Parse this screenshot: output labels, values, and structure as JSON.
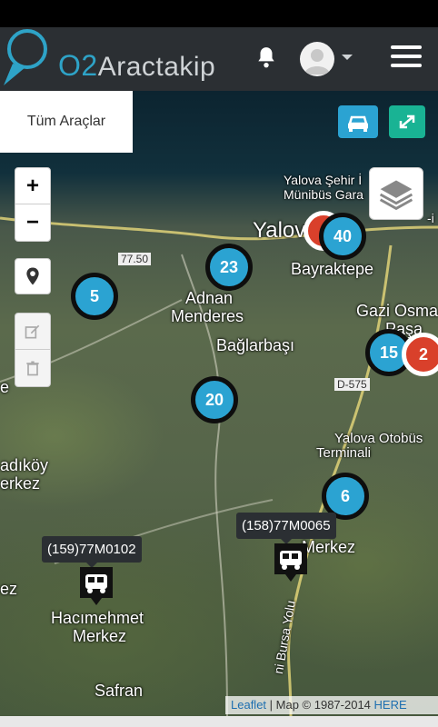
{
  "app": {
    "logo_prefix": "O2",
    "logo_suffix": "Aractakip"
  },
  "header": {
    "bell_icon": "bell-icon",
    "avatar_icon": "user-avatar-icon",
    "menu_icon": "hamburger-menu-icon"
  },
  "filter": {
    "tab_label": "Tüm Araçlar"
  },
  "toolbar": {
    "vehicle_button_icon": "car-icon",
    "fullscreen_button_icon": "expand-icon",
    "accent_blue": "#2ba3d2",
    "accent_green": "#19b394"
  },
  "map_controls": {
    "zoom_in": "+",
    "zoom_out": "−",
    "locate_icon": "map-pin-icon",
    "edit_icon": "edit-icon",
    "delete_icon": "trash-icon",
    "layers_icon": "layers-icon"
  },
  "place_labels": {
    "yalova_sehir": "Yalova Şehir İ",
    "munibus": "Münibüs Gara",
    "yalova": "Yalova",
    "yalova_i": "-i",
    "bayraktepe": "Bayraktepe",
    "adnan": "Adnan",
    "menderes": "Menderes",
    "baglarbasi": "Bağlarbaşı",
    "gazi_osma": "Gazi Osma",
    "pasa": "Paşa",
    "road_750": "77.50",
    "road_d575": "D-575",
    "otobus": "Yalova Otobüs",
    "terminali": "Terminali",
    "adikoy": "adıköy",
    "merkez_left": "erkez",
    "merkez_mid": "Merkez",
    "ez": "ez",
    "hacimehmet": "Hacımehmet",
    "hacimerkez": "Merkez",
    "safran": "Safran",
    "bursa_yolu": "ni Bursa Yolu",
    "e_left": "e"
  },
  "clusters": [
    {
      "count": "5",
      "color": "blue"
    },
    {
      "count": "23",
      "color": "blue"
    },
    {
      "count": "40",
      "color": "blue"
    },
    {
      "count": "15",
      "color": "blue"
    },
    {
      "count": "2",
      "color": "red"
    },
    {
      "count": "20",
      "color": "blue"
    },
    {
      "count": "6",
      "color": "blue"
    }
  ],
  "vehicles": [
    {
      "plate": "(159)77M0102",
      "icon": "bus-marker-icon"
    },
    {
      "plate": "(158)77M0065",
      "icon": "bus-marker-icon"
    }
  ],
  "attribution": {
    "leaflet": "Leaflet",
    "map_text": " | Map © 1987-2014 ",
    "here": "HERE"
  }
}
